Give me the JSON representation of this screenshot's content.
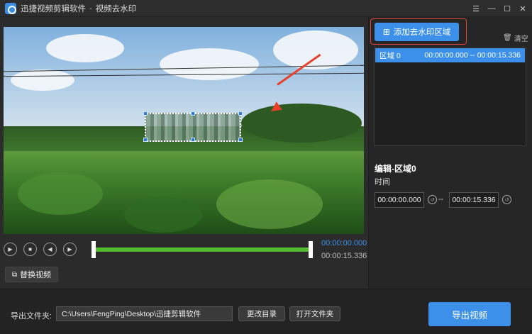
{
  "window": {
    "app_name": "迅捷视频剪辑软件",
    "separator": "-",
    "page_title": "视频去水印",
    "controls": {
      "menu": "☰",
      "minimize": "—",
      "maximize": "☐",
      "close": "✕"
    }
  },
  "player": {
    "current_time": "00:00:00.000",
    "total_time": "00:00:15.336",
    "replace_video_label": "替换视频"
  },
  "watermark": {
    "add_region_label": "添加去水印区域",
    "clear_label": "清空",
    "regions": [
      {
        "name": "区域 0",
        "start": "00:00:00.000",
        "separator": "--",
        "end": "00:00:15.336"
      }
    ],
    "edit_title": "编辑-区域0",
    "time_label": "时间",
    "start_time": "00:00:00.000",
    "end_time": "00:00:15.336",
    "range_sep": "--"
  },
  "bottom": {
    "export_folder_label": "导出文件夹:",
    "export_path": "C:\\Users\\FengPing\\Desktop\\迅捷剪辑软件",
    "change_dir_label": "更改目录",
    "open_folder_label": "打开文件夹",
    "export_video_label": "导出视频"
  },
  "colors": {
    "accent": "#3c90ea",
    "highlight_border": "#e0443a",
    "timeline": "#4fbd2f"
  }
}
